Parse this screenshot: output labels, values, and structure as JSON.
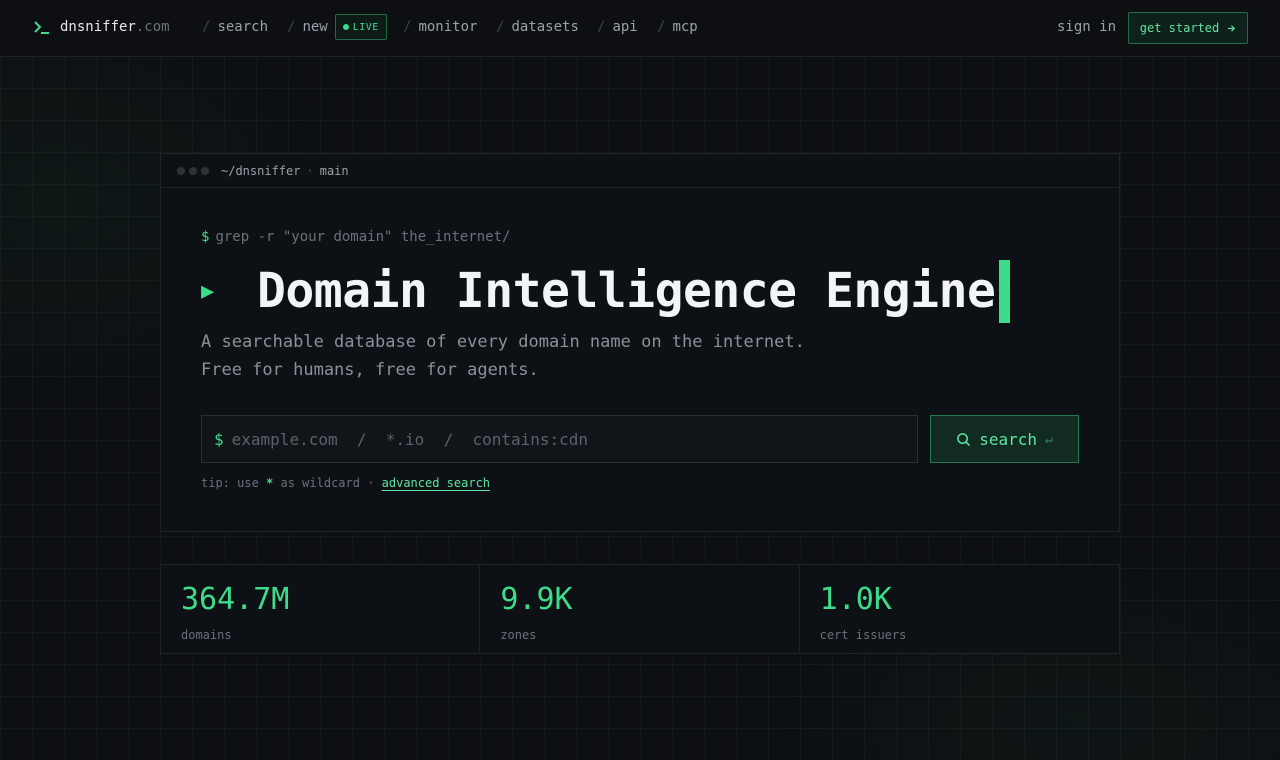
{
  "brand": {
    "name": "dnsniffer",
    "tld": ".com"
  },
  "nav": {
    "items": [
      "search",
      "new",
      "monitor",
      "datasets",
      "api",
      "mcp"
    ],
    "live_badge": "LIVE",
    "sign_in": "sign in",
    "get_started": "get started"
  },
  "panel": {
    "path": "~/dnsniffer",
    "branch": "main",
    "command": "grep -r \"your domain\" the_internet/",
    "title": "Domain Intelligence Engine",
    "subtitle_line1": "A searchable database of every domain name on the internet.",
    "subtitle_line2": "Free for humans, free for agents.",
    "search_placeholder": "example.com  /  *.io  /  contains:cdn",
    "search_button": "search",
    "tip_prefix": "tip: use",
    "tip_star": "*",
    "tip_mid": "as wildcard ·",
    "tip_link": "advanced search"
  },
  "stats": [
    {
      "value": "364.7M",
      "label": "domains"
    },
    {
      "value": "9.9K",
      "label": "zones"
    },
    {
      "value": "1.0K",
      "label": "cert issuers"
    }
  ],
  "colors": {
    "accent": "#3ddc8b",
    "background": "#0d0f12",
    "border": "#1f242a"
  },
  "icons": [
    "terminal-logo-icon",
    "live-dot-icon",
    "arrow-right-icon",
    "search-icon",
    "enter-key-icon",
    "play-icon"
  ]
}
